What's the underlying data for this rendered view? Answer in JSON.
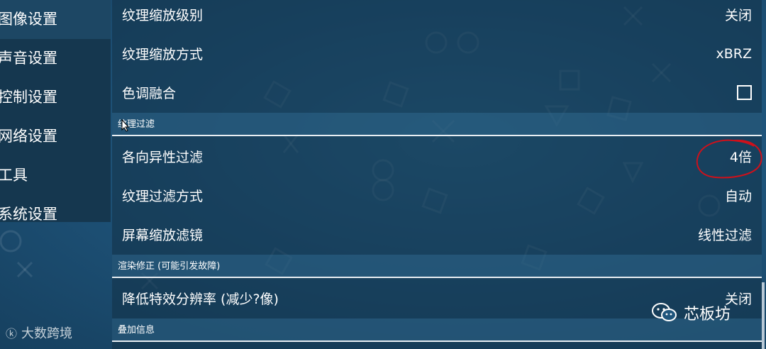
{
  "sidebar": {
    "items": [
      {
        "label": "图像设置"
      },
      {
        "label": "声音设置"
      },
      {
        "label": "控制设置"
      },
      {
        "label": "网络设置"
      },
      {
        "label": "工具"
      },
      {
        "label": "系统设置"
      }
    ]
  },
  "settings": {
    "tex_scale_level": {
      "label": "纹理缩放级别",
      "value": "关闭"
    },
    "tex_scale_method": {
      "label": "纹理缩放方式",
      "value": "xBRZ"
    },
    "hue_blend": {
      "label": "色调融合",
      "checked": false
    },
    "section_filter": "纹理过滤",
    "aniso_filter": {
      "label": "各向异性过滤",
      "value": "4倍"
    },
    "tex_filter_mode": {
      "label": "纹理过滤方式",
      "value": "自动"
    },
    "screen_filter": {
      "label": "屏幕缩放滤镜",
      "value": "线性过滤"
    },
    "section_render_fix": "渲染修正 (可能引发故障)",
    "lower_effects_res": {
      "label": "降低特效分辨率 (减少?像)",
      "value": "关闭"
    },
    "section_overlay": "叠加信息"
  },
  "watermarks": {
    "left": "大数跨境",
    "right": "芯板坊"
  },
  "colors": {
    "annotation": "#d0101a",
    "background": "#1f557c"
  }
}
